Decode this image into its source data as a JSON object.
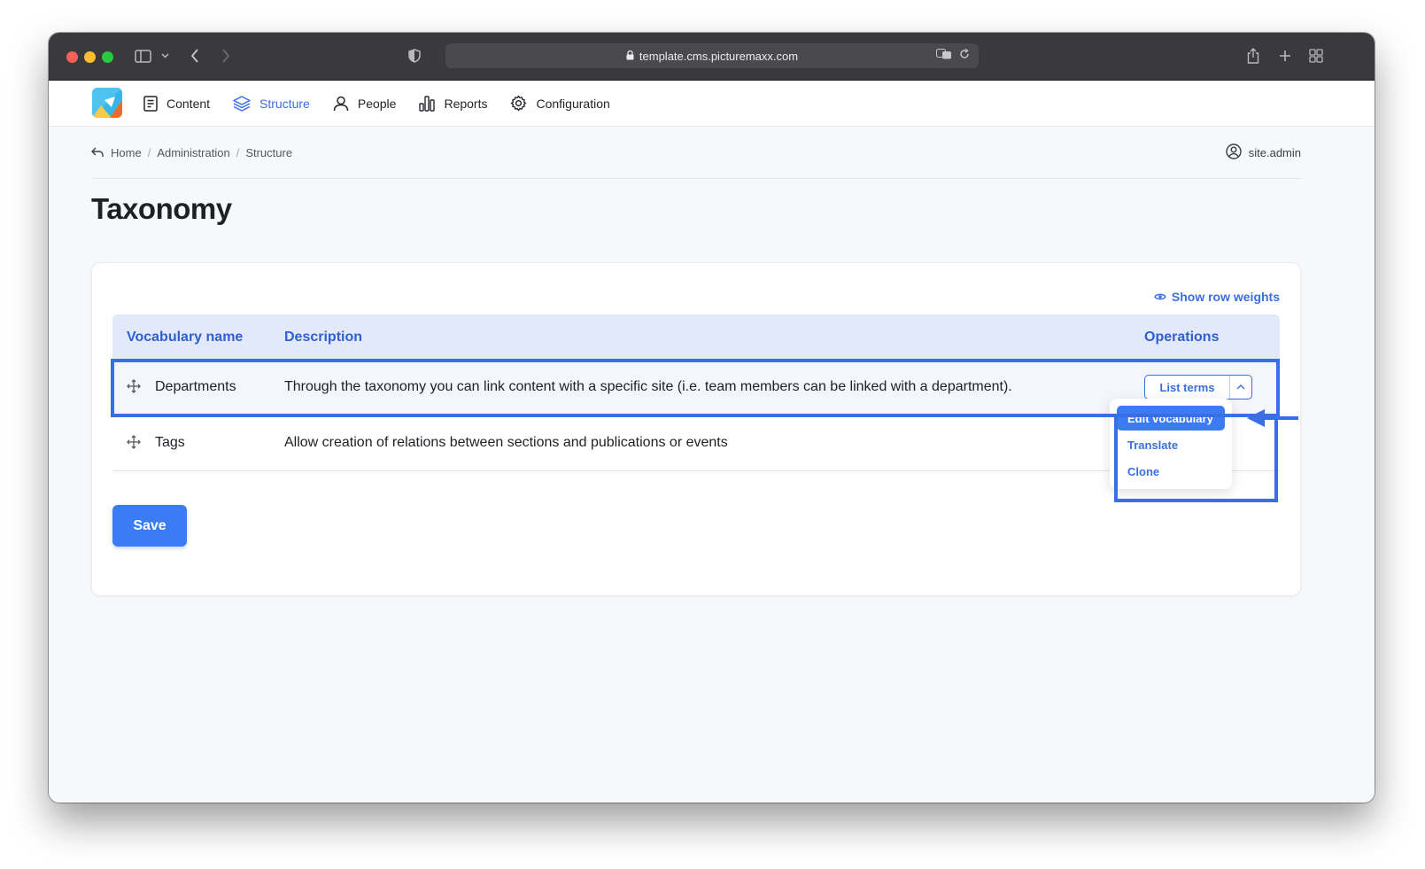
{
  "browser": {
    "url": "template.cms.picturemaxx.com",
    "icons": [
      "sidebar-icon",
      "chevron-down-icon",
      "back-icon",
      "forward-icon",
      "shield-icon",
      "lock-icon",
      "translate-icon",
      "reload-icon",
      "share-icon",
      "new-tab-icon",
      "tab-overview-icon"
    ]
  },
  "nav": {
    "items": [
      {
        "label": "Content",
        "icon": "document-icon",
        "active": false
      },
      {
        "label": "Structure",
        "icon": "layers-icon",
        "active": true
      },
      {
        "label": "People",
        "icon": "person-icon",
        "active": false
      },
      {
        "label": "Reports",
        "icon": "bar-chart-icon",
        "active": false
      },
      {
        "label": "Configuration",
        "icon": "gear-icon",
        "active": false
      }
    ]
  },
  "breadcrumb": {
    "items": [
      "Home",
      "Administration",
      "Structure"
    ],
    "separator": "/"
  },
  "user": {
    "name": "site.admin"
  },
  "page": {
    "title": "Taxonomy"
  },
  "table": {
    "show_weights": "Show row weights",
    "headers": {
      "name": "Vocabulary name",
      "description": "Description",
      "operations": "Operations"
    },
    "rows": [
      {
        "name": "Departments",
        "description": "Through the taxonomy you can link content with a specific site (i.e. team members can be linked with a department).",
        "operation": "List terms"
      },
      {
        "name": "Tags",
        "description": "Allow creation of relations between sections and publications or events"
      }
    ]
  },
  "dropdown": {
    "items": [
      {
        "label": "Edit vocabulary",
        "active": true
      },
      {
        "label": "Translate",
        "active": false
      },
      {
        "label": "Clone",
        "active": false
      }
    ]
  },
  "form": {
    "save_label": "Save"
  },
  "colors": {
    "accent": "#3b7cf5",
    "link": "#3a6fe0",
    "header_bg": "#e2e9fb",
    "highlight": "#3a6ee6"
  }
}
